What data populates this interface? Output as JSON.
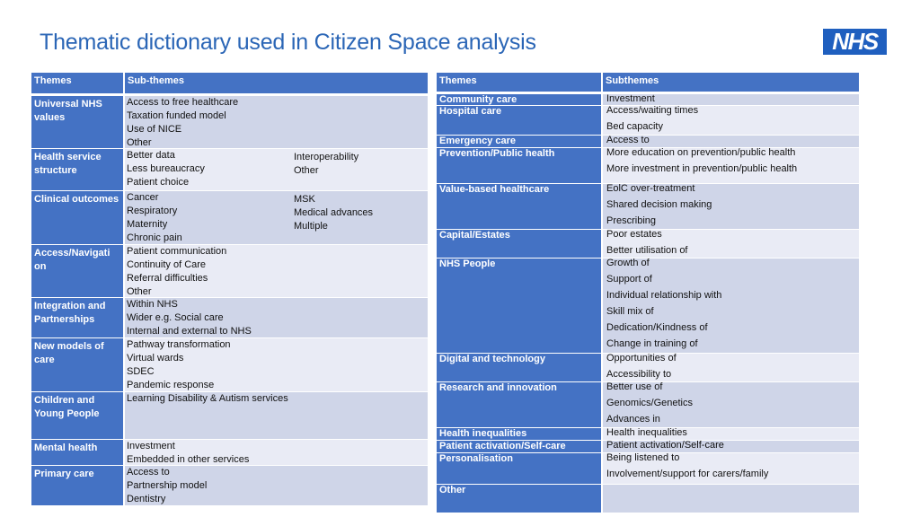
{
  "page": {
    "title": "Thematic dictionary used in Citizen Space analysis",
    "logo": "NHS"
  },
  "left_table": {
    "headers": [
      "Themes",
      "Sub-themes"
    ],
    "rows": [
      {
        "theme": "Universal NHS values",
        "col1": [
          "Access to free healthcare",
          "Taxation funded model",
          "Use of NICE",
          "Other"
        ],
        "col2": []
      },
      {
        "theme": "Health service structure",
        "col1": [
          "Better data",
          "Less bureaucracy",
          "Patient choice"
        ],
        "col2": [
          "Interoperability",
          "Other"
        ]
      },
      {
        "theme": "Clinical outcomes",
        "col1": [
          "Cancer",
          "Respiratory",
          "Maternity",
          "Chronic pain"
        ],
        "col2": [
          "MSK",
          "Medical advances",
          "Multiple"
        ]
      },
      {
        "theme": "Access/Navigati on",
        "col1": [
          "Patient communication",
          "Continuity of Care",
          "Referral difficulties",
          "Other"
        ],
        "col2": []
      },
      {
        "theme": "Integration and Partnerships",
        "col1": [
          "Within NHS",
          "Wider e.g. Social care",
          "Internal and external to NHS"
        ],
        "col2": []
      },
      {
        "theme": "New models of care",
        "col1": [
          "Pathway transformation",
          "Virtual wards",
          "SDEC",
          "Pandemic response"
        ],
        "col2": []
      },
      {
        "theme": "Children and Young People",
        "col1": [
          "Learning Disability & Autism services"
        ],
        "col2": []
      },
      {
        "theme": "Mental health",
        "col1": [
          "Investment",
          "Embedded in other services"
        ],
        "col2": []
      },
      {
        "theme": "Primary care",
        "col1": [
          "Access to",
          "Partnership model",
          "Dentistry"
        ],
        "col2": []
      }
    ]
  },
  "right_table": {
    "headers": [
      "Themes",
      "Subthemes"
    ],
    "rows": [
      {
        "theme": "Community care",
        "subs": [
          "Investment"
        ]
      },
      {
        "theme": "Hospital care",
        "subs": [
          "Access/waiting times",
          "Bed capacity"
        ]
      },
      {
        "theme": "Emergency care",
        "subs": [
          "Access to"
        ]
      },
      {
        "theme": "Prevention/Public health",
        "subs": [
          "More education on prevention/public health",
          "More investment in prevention/public health"
        ]
      },
      {
        "theme": "Value-based healthcare",
        "subs": [
          "EolC over-treatment",
          "Shared decision making",
          "Prescribing"
        ]
      },
      {
        "theme": "Capital/Estates",
        "subs": [
          "Poor estates",
          "Better utilisation of"
        ]
      },
      {
        "theme": "NHS People",
        "subs": [
          "Growth of",
          "Support of",
          "Individual relationship with",
          "Skill mix of",
          "Dedication/Kindness of",
          "Change in training of"
        ]
      },
      {
        "theme": "Digital and technology",
        "subs": [
          "Opportunities of",
          "Accessibility to"
        ]
      },
      {
        "theme": "Research and innovation",
        "subs": [
          "Better use of",
          "Genomics/Genetics",
          "Advances in"
        ]
      },
      {
        "theme": "Health inequalities",
        "subs": [
          "Health inequalities"
        ]
      },
      {
        "theme": "Patient activation/Self-care",
        "subs": [
          "Patient activation/Self-care"
        ]
      },
      {
        "theme": "Personalisation",
        "subs": [
          "Being listened to",
          "Involvement/support for carers/family"
        ]
      },
      {
        "theme": "Other",
        "subs": []
      }
    ]
  },
  "colors": {
    "header_blue": "#4472c4",
    "row_dark": "#cfd5e8",
    "row_light": "#e9ebf5",
    "title_blue": "#2b66b6",
    "nhs_blue": "#1f5fbf"
  }
}
